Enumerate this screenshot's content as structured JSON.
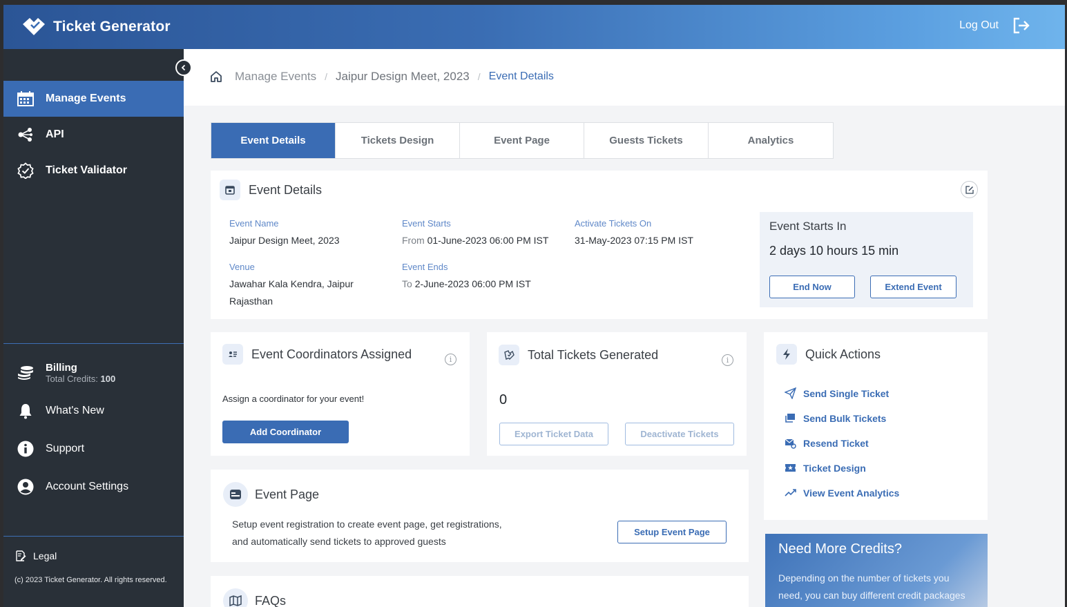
{
  "app": {
    "name": "Ticket Generator",
    "logout_label": "Log Out"
  },
  "sidebar": {
    "items": [
      {
        "label": "Manage Events",
        "icon": "calendar-icon"
      },
      {
        "label": "API",
        "icon": "share-icon"
      },
      {
        "label": "Ticket Validator",
        "icon": "check-badge-icon"
      }
    ],
    "billing": {
      "label": "Billing",
      "credits_label": "Total Credits:",
      "credits_value": "100"
    },
    "bottom_items": [
      {
        "label": "What's New",
        "icon": "bell-icon"
      },
      {
        "label": "Support",
        "icon": "info-icon"
      },
      {
        "label": "Account Settings",
        "icon": "user-icon"
      }
    ],
    "legal": "Legal",
    "copyright": "(c) 2023 Ticket Generator. All rights reserved."
  },
  "breadcrumb": {
    "root": "Manage Events",
    "event": "Jaipur Design Meet, 2023",
    "current": "Event Details"
  },
  "tabs": [
    "Event Details",
    "Tickets Design",
    "Event Page",
    "Guests Tickets",
    "Analytics"
  ],
  "event_details": {
    "title": "Event Details",
    "name_label": "Event Name",
    "name": "Jaipur Design Meet, 2023",
    "starts_label": "Event Starts",
    "starts_prefix": "From",
    "starts": "01-June-2023 06:00 PM IST",
    "activate_label": "Activate Tickets On",
    "activate": "31-May-2023 07:15 PM IST",
    "venue_label": "Venue",
    "venue_line1": "Jawahar Kala Kendra, Jaipur",
    "venue_line2": "Rajasthan",
    "ends_label": "Event Ends",
    "ends_prefix": "To",
    "ends": "2-June-2023 06:00 PM IST",
    "starts_in_label": "Event Starts In",
    "starts_in": "2 days 10 hours 15 min",
    "end_now": "End Now",
    "extend": "Extend Event"
  },
  "coordinators": {
    "title": "Event Coordinators Assigned",
    "message": "Assign a coordinator for your event!",
    "button": "Add Coordinator"
  },
  "tickets": {
    "title": "Total Tickets Generated",
    "count": "0",
    "export": "Export Ticket Data",
    "deactivate": "Deactivate Tickets"
  },
  "quick_actions": {
    "title": "Quick Actions",
    "items": [
      "Send Single Ticket",
      "Send Bulk Tickets",
      "Resend Ticket",
      "Ticket Design",
      "View Event Analytics"
    ]
  },
  "event_page": {
    "title": "Event Page",
    "desc_line1": "Setup event registration to create event page, get registrations,",
    "desc_line2": "and automatically send tickets to approved guests",
    "button": "Setup Event Page"
  },
  "faqs": {
    "title": "FAQs"
  },
  "credits": {
    "title": "Need More Credits?",
    "line1": "Depending on the number of tickets you",
    "line2": "need, you can buy different credit packages"
  },
  "colors": {
    "primary": "#3a6cb4",
    "sidebar": "#293038",
    "header_start": "#2b5596",
    "header_end": "#6fb4ec"
  }
}
